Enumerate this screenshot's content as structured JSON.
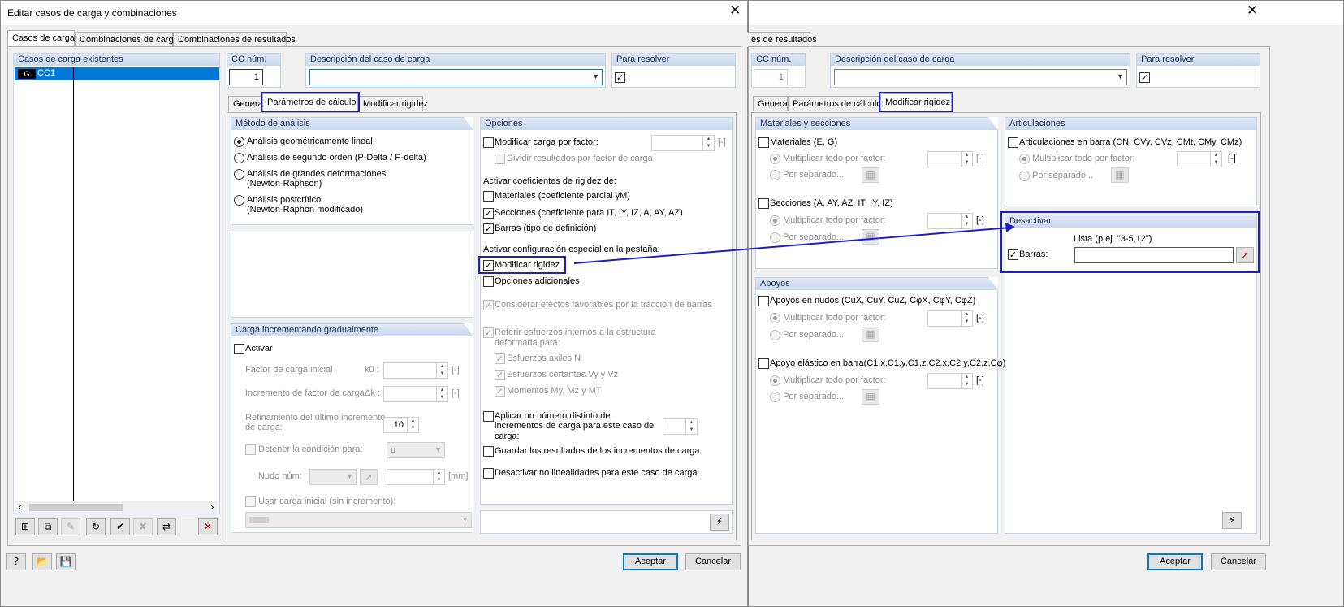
{
  "left": {
    "window_title": "Editar casos de carga y combinaciones",
    "tabs": [
      "Casos de carga",
      "Combinaciones de carga",
      "Combinaciones de resultados"
    ],
    "existing_header": "Casos de carga existentes",
    "list_item": {
      "badge": "G",
      "name": "CC1"
    },
    "cc_num_label": "CC núm.",
    "cc_num_value": "1",
    "desc_label": "Descripción del caso de carga",
    "desc_value": "",
    "solve_label": "Para resolver",
    "subtabs": [
      "General",
      "Parámetros de cálculo",
      "Modificar rigidez"
    ],
    "metodo": {
      "header": "Método de análisis",
      "options": [
        "Análisis geométricamente lineal",
        "Análisis de segundo orden (P-Delta / P-delta)",
        "Análisis de grandes deformaciones",
        "(Newton-Raphson)",
        "Análisis postcrítico",
        "(Newton-Raphon modificado)"
      ]
    },
    "carga": {
      "header": "Carga incrementando gradualmente",
      "activar": "Activar",
      "factor_inicial": "Factor de carga inicial",
      "k0": "k0 :",
      "incremento": "Incremento de factor de carga",
      "dk": "Δk :",
      "unit": "[-]",
      "refinamiento_1": "Refinamiento del último incremento",
      "refinamiento_2": "de carga:",
      "refinamiento_value": "10",
      "detener": "Detener la condición para:",
      "detener_value": "u",
      "nudo": "Nudo núm:",
      "mm": "[mm]",
      "usar": "Usar carga inicial (sin incremento):"
    },
    "opciones": {
      "header": "Opciones",
      "modificar_carga": "Modificar carga por factor:",
      "dividir": "Dividir resultados por factor de carga",
      "unit": "[-]",
      "activar_coef": "Activar coeficientes de rigidez de:",
      "materiales": "Materiales (coeficiente parcial γM)",
      "secciones": "Secciones (coeficiente para IT, IY, IZ, A, AY, AZ)",
      "barras": "Barras (tipo de definición)",
      "activar_conf": "Activar configuración especial en la pestaña:",
      "modificar_rigidez": "Modificar rigidez",
      "opciones_adicionales": "Opciones adicionales",
      "considerar": "Considerar efectos favorables por la tracción de barras",
      "referir_1": "Referir esfuerzos internos a la estructura",
      "referir_2": "deformada para:",
      "axiles": "Esfuerzos axiles N",
      "cortantes": "Esfuerzos cortantes Vy y Vz",
      "momentos": "Momentos My, Mz y MT",
      "aplicar_1": "Aplicar un número distinto de",
      "aplicar_2": "incrementos de carga para este caso de",
      "aplicar_3": "carga:",
      "guardar": "Guardar los resultados de los incrementos de carga",
      "desactivar": "Desactivar no linealidades para este caso de carga"
    },
    "ok": "Aceptar",
    "cancel": "Cancelar"
  },
  "right": {
    "tab_partial": "es de resultados",
    "cc_num_label": "CC núm.",
    "cc_num_value": "1",
    "desc_label": "Descripción del caso de carga",
    "solve_label": "Para resolver",
    "subtabs": [
      "General",
      "Parámetros de cálculo",
      "Modificar rigidez"
    ],
    "mat_sec": {
      "header": "Materiales y secciones",
      "materiales": "Materiales (E, G)",
      "multiplicar": "Multiplicar todo por factor:",
      "separado": "Por separado...",
      "unit": "[-]",
      "secciones": "Secciones (A, AY, AZ, IT, IY, IZ)"
    },
    "articulaciones": {
      "header": "Articulaciones",
      "en_barra": "Articulaciones en barra  (CN, CVy, CVz, CMt, CMy, CMz)",
      "multiplicar": "Multiplicar todo por factor:",
      "separado": "Por separado...",
      "unit": "[-]"
    },
    "desactivar": {
      "header": "Desactivar",
      "lista": "Lista (p.ej. \"3-5,12\")",
      "barras": "Barras:"
    },
    "apoyos": {
      "header": "Apoyos",
      "nudos": "Apoyos en nudos (CuX, CuY, CuZ, CφX, CφY, CφZ)",
      "multiplicar": "Multiplicar todo por factor:",
      "separado": "Por separado...",
      "unit": "[-]",
      "elastico": "Apoyo elástico en barra(C1,x,C1,y,C1,z,C2,x,C2,y,C2,z,Cφ)"
    },
    "ok": "Aceptar",
    "cancel": "Cancelar"
  },
  "colors": {
    "highlight": "#1e1ec8",
    "selection": "#0078d7",
    "group_header": "#c9d7ec"
  }
}
